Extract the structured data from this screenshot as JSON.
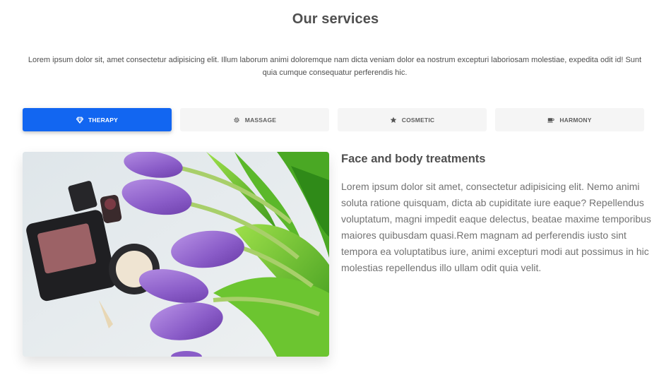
{
  "section": {
    "title": "Our services",
    "intro": "Lorem ipsum dolor sit, amet consectetur adipisicing elit. Illum laborum animi doloremque nam dicta veniam dolor ea nostrum excepturi laboriosam molestiae, expedita odit id! Sunt quia cumque consequatur perferendis hic."
  },
  "tabs": [
    {
      "label": "Therapy",
      "icon": "gem-icon",
      "active": true
    },
    {
      "label": "Massage",
      "icon": "gear-icon",
      "active": false
    },
    {
      "label": "Cosmetic",
      "icon": "star-icon",
      "active": false
    },
    {
      "label": "Harmony",
      "icon": "coffee-cup-icon",
      "active": false
    }
  ],
  "content": {
    "title": "Face and body treatments",
    "body": "Lorem ipsum dolor sit amet, consectetur adipisicing elit. Nemo animi soluta ratione quisquam, dicta ab cupiditate iure eaque? Repellendus voluptatum, magni impedit eaque delectus, beatae maxime temporibus maiores quibusdam quasi.Rem magnam ad perferendis iusto sint tempora ea voluptatibus iure, animi excepturi modi aut possimus in hic molestias repellendus illo ullam odit quia velit."
  },
  "colors": {
    "accent": "#1266f1",
    "tab_bg": "#f5f5f5",
    "text": "#4f4f4f",
    "muted_text": "#727272"
  }
}
